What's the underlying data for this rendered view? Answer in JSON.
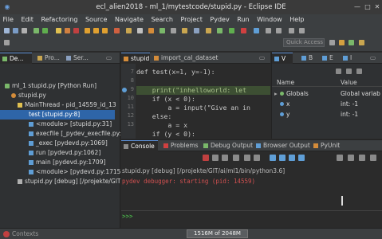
{
  "window": {
    "title": "ecl_alien2018 - ml_1/mytestcode/stupid.py - Eclipse IDE"
  },
  "menu": [
    "File",
    "Edit",
    "Refactoring",
    "Source",
    "Navigate",
    "Search",
    "Project",
    "Pydev",
    "Run",
    "Window",
    "Help"
  ],
  "toolbar": {
    "quick_access_placeholder": "Quick Access"
  },
  "left_panel": {
    "tabs": [
      "De...",
      "Pro...",
      "Ser..."
    ],
    "tree": [
      {
        "label": "ml_1 stupid.py [Python Run]",
        "indent": 0
      },
      {
        "label": "stupid.py",
        "indent": 1
      },
      {
        "label": "MainThread - pid_14559_id_13",
        "indent": 2
      },
      {
        "label": "test [stupid.py:8]",
        "indent": 3,
        "selected": true
      },
      {
        "label": "<module> [stupid.py:31]",
        "indent": 3
      },
      {
        "label": "execfile [_pydev_execfile.py:",
        "indent": 3
      },
      {
        "label": "_exec [pydevd.py:1069]",
        "indent": 3
      },
      {
        "label": "run [pydevd.py:1062]",
        "indent": 3
      },
      {
        "label": "main [pydevd.py:1709]",
        "indent": 3
      },
      {
        "label": "<module> [pydevd.py:1715]",
        "indent": 3
      },
      {
        "label": "stupid.py [debug] [/projekte/GIT",
        "indent": 1
      }
    ]
  },
  "editor": {
    "tabs": [
      "stupid",
      "import_cal_dataset"
    ],
    "line_numbers": [
      "7",
      "8",
      "9",
      "10",
      "11",
      "12",
      "13"
    ],
    "lines": [
      "def test(x=1, y=-1):",
      "    print(\"inhelloworld: let",
      "    if (x < 0):",
      "        a = input(\"Give an in",
      "    else:",
      "        a = x",
      "    if (y < 0):"
    ]
  },
  "variables": {
    "tabs": [
      "V",
      "B",
      "E",
      "I"
    ],
    "columns": [
      "Name",
      "Value"
    ],
    "rows": [
      {
        "name": "Globals",
        "value": "Global variab"
      },
      {
        "name": "x",
        "value": "int: -1"
      },
      {
        "name": "y",
        "value": "int: -1"
      }
    ]
  },
  "console": {
    "tabs": [
      "Console",
      "Problems",
      "Debug Output",
      "Browser Output",
      "PyUnit"
    ],
    "header": "stupid.py [debug] [/projekte/GIT/ai/ml1/bin/python3.6]",
    "output": "pydev debugger: starting (pid: 14559)",
    "prompt": ">>>"
  },
  "status": {
    "left": "Contexts",
    "heap": "1516M of 2048M"
  },
  "colors": {
    "accent": "#2e65a8",
    "error": "#d05050",
    "prompt": "#4ec94e"
  }
}
